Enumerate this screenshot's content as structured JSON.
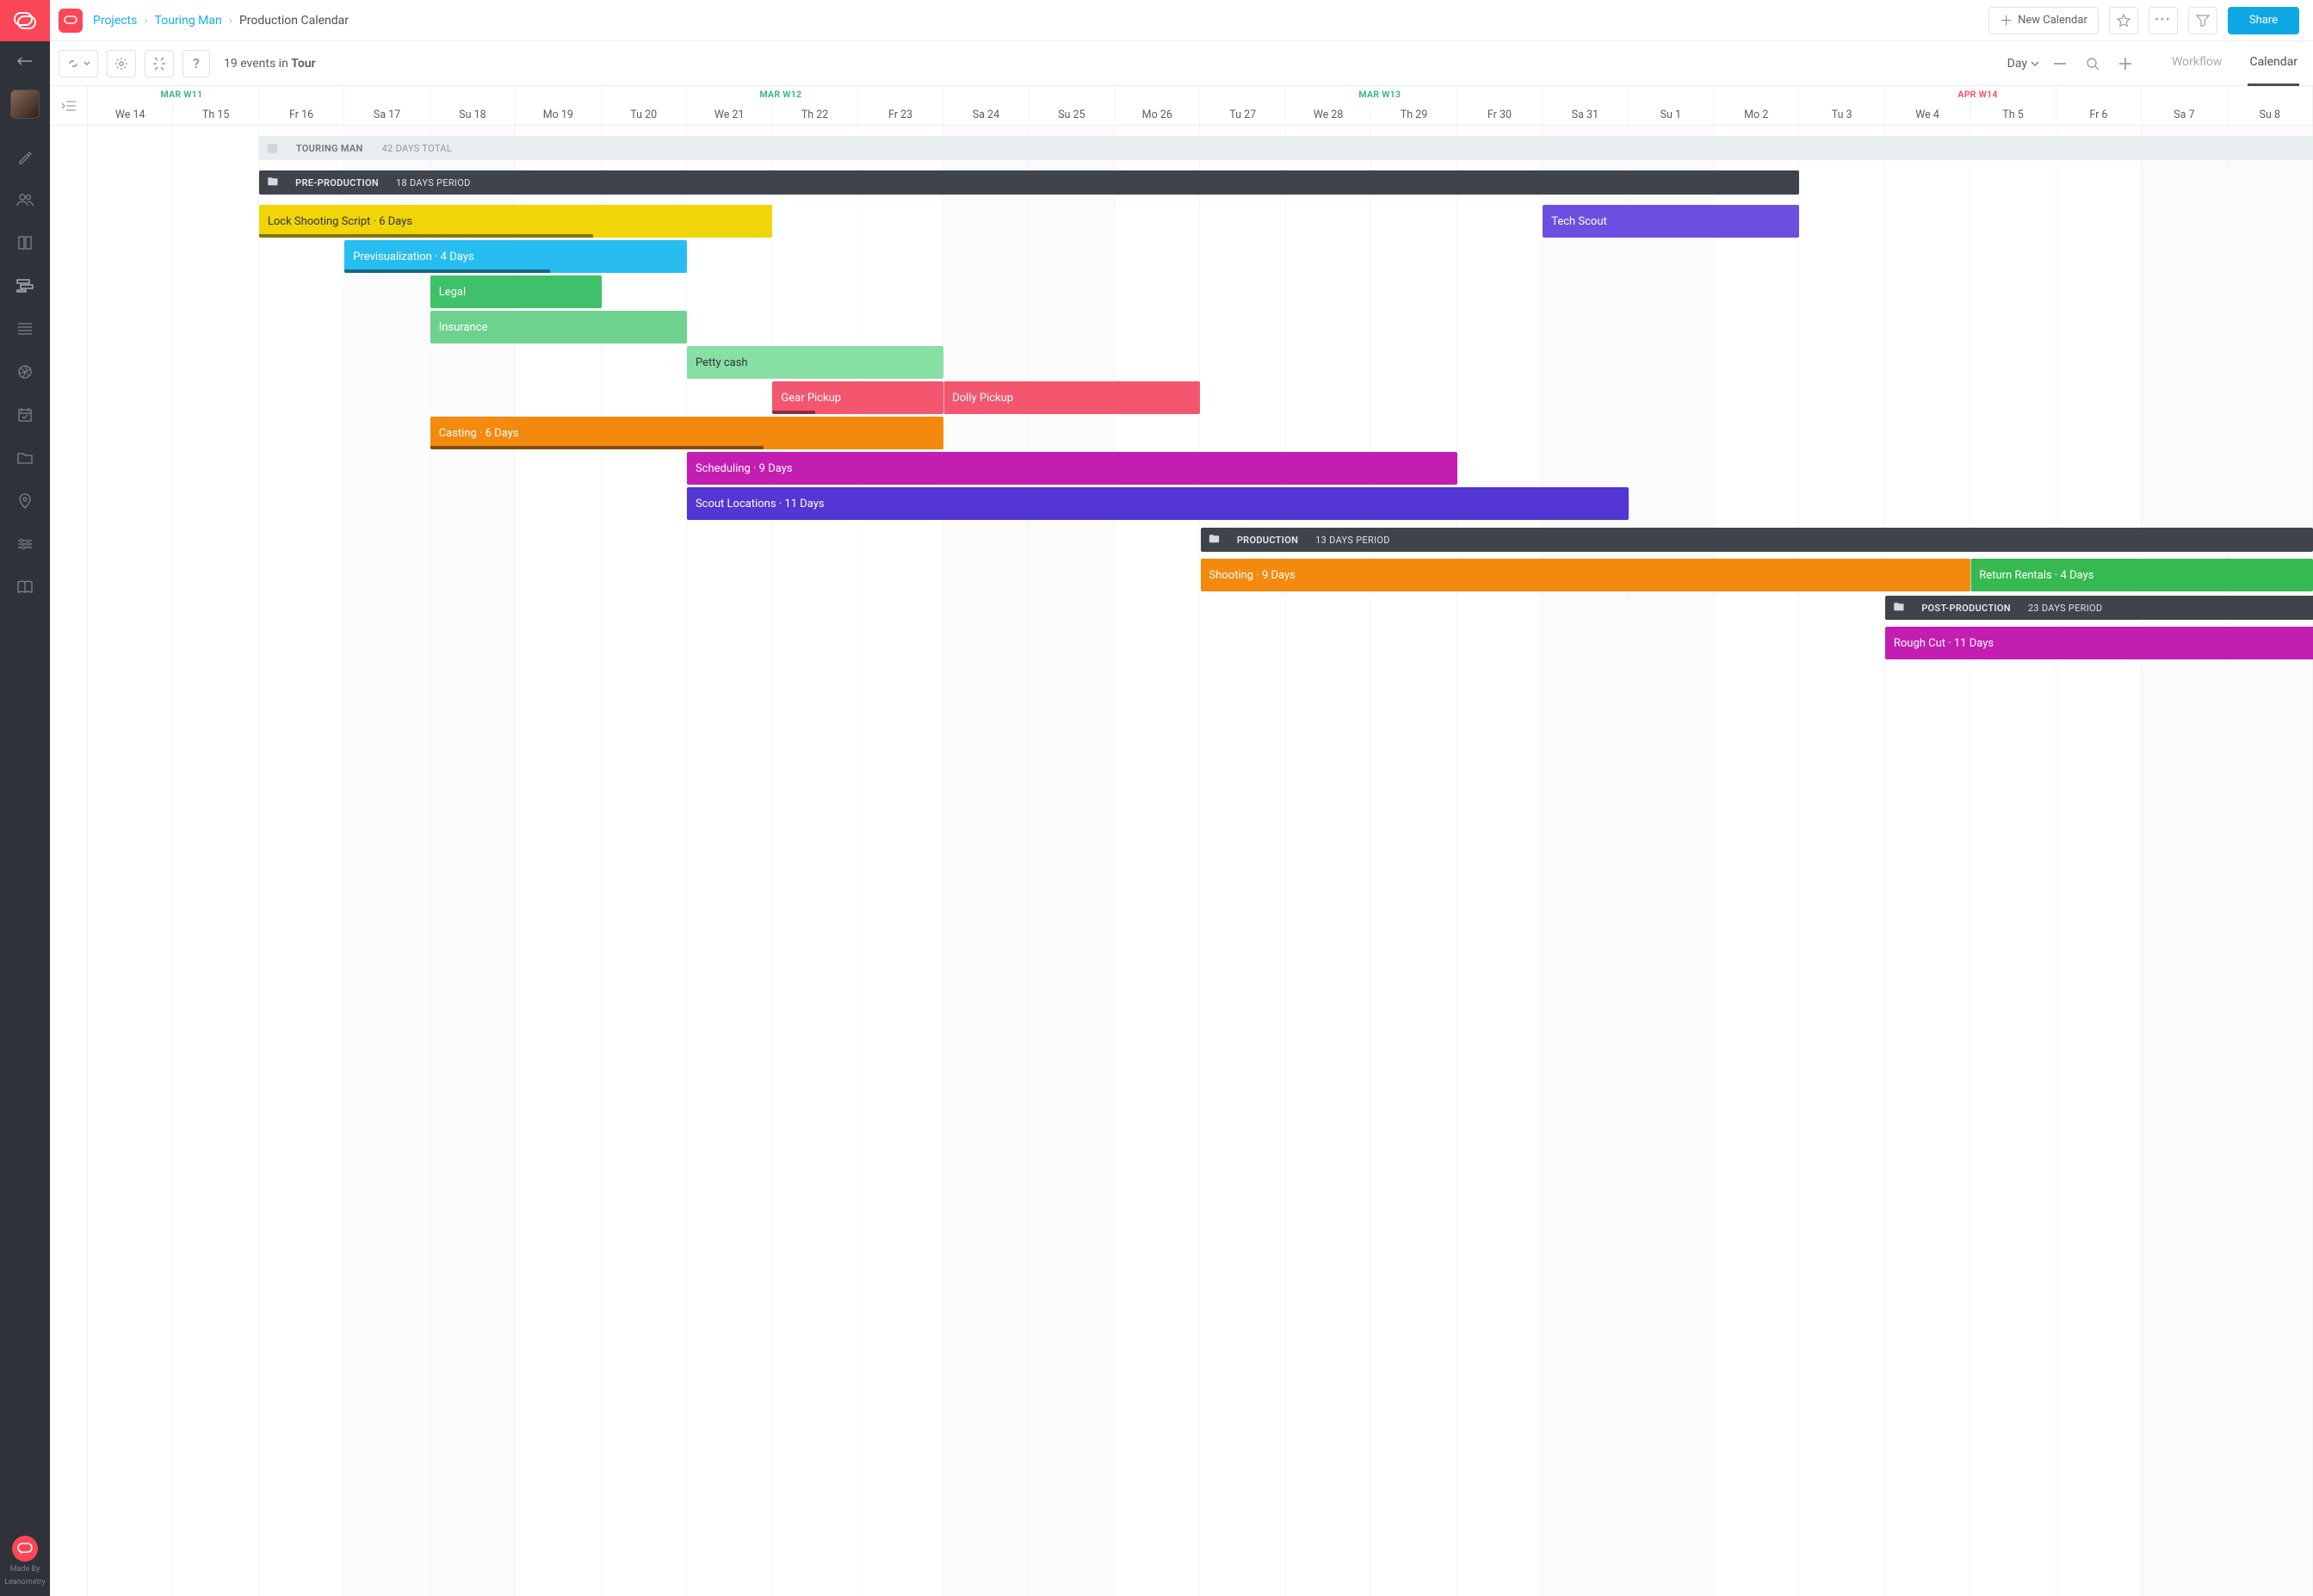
{
  "breadcrumb": {
    "projects": "Projects",
    "project": "Touring Man",
    "page": "Production Calendar"
  },
  "header": {
    "new_calendar": "New Calendar",
    "share": "Share"
  },
  "toolbar": {
    "status_count": "19 events in ",
    "status_bold": "Tour",
    "zoom_label": "Day",
    "tab_workflow": "Workflow",
    "tab_calendar": "Calendar"
  },
  "weeks": [
    {
      "label": "MAR  W11",
      "cls": "mar",
      "col": 1
    },
    {
      "label": "MAR  W12",
      "cls": "mar",
      "col": 8
    },
    {
      "label": "MAR  W13",
      "cls": "mar",
      "col": 15
    },
    {
      "label": "APR  W14",
      "cls": "apr",
      "col": 22
    }
  ],
  "days": [
    "We 14",
    "Th 15",
    "Fr 16",
    "Sa 17",
    "Su 18",
    "Mo 19",
    "Tu 20",
    "We 21",
    "Th 22",
    "Fr 23",
    "Sa 24",
    "Su 25",
    "Mo 26",
    "Tu 27",
    "We 28",
    "Th 29",
    "Fr 30",
    "Sa 31",
    "Su 1",
    "Mo 2",
    "Tu 3",
    "We 4",
    "Th 5",
    "Fr 6",
    "Sa 7",
    "Su 8"
  ],
  "weekend_cols": [
    3,
    4,
    10,
    11,
    17,
    18,
    24,
    25
  ],
  "rows": {
    "summary": {
      "label": "TOURING MAN",
      "sub": "42 DAYS TOTAL",
      "start": 2,
      "span": 25
    },
    "pre_phase": {
      "label": "PRE-PRODUCTION",
      "sub": "18 DAYS PERIOD",
      "start": 2,
      "span": 18
    },
    "prod_phase": {
      "label": "PRODUCTION",
      "sub": "13 DAYS PERIOD",
      "start": 13,
      "span": 13
    },
    "post_phase": {
      "label": "POST-PRODUCTION",
      "sub": "23 DAYS PERIOD",
      "start": 21,
      "span": 6
    }
  },
  "tasks": [
    {
      "id": "lock",
      "label": "Lock Shooting Script · 6 Days",
      "start": 2,
      "span": 6,
      "color": "#f1d506",
      "text": "light",
      "row": 0,
      "prog": 65
    },
    {
      "id": "tech",
      "label": "Tech Scout",
      "start": 17,
      "span": 3,
      "color": "#6b4fe0",
      "row": 0
    },
    {
      "id": "previz",
      "label": "Previsualization · 4 Days",
      "start": 3,
      "span": 4,
      "color": "#28bdf1",
      "row": 1,
      "prog": 60
    },
    {
      "id": "legal",
      "label": "Legal",
      "start": 4,
      "span": 2,
      "color": "#3fc06a",
      "row": 2
    },
    {
      "id": "ins",
      "label": "Insurance",
      "start": 4,
      "span": 3,
      "color": "#6dd28e",
      "row": 3
    },
    {
      "id": "petty",
      "label": "Petty cash",
      "start": 7,
      "span": 3,
      "color": "#88dfa4",
      "text": "light",
      "row": 4
    },
    {
      "id": "gear",
      "label": "Gear Pickup",
      "start": 8,
      "span": 2,
      "color": "#f5566f",
      "row": 5,
      "prog": 25
    },
    {
      "id": "dolly",
      "label": "Dolly Pickup",
      "start": 10,
      "span": 3,
      "color": "#f5566f",
      "row": 5,
      "sep": true
    },
    {
      "id": "cast",
      "label": "Casting · 6 Days",
      "start": 4,
      "span": 6,
      "color": "#f38a0e",
      "row": 6,
      "prog": 65
    },
    {
      "id": "sched",
      "label": "Scheduling · 9 Days",
      "start": 7,
      "span": 9,
      "color": "#c31db1",
      "row": 7
    },
    {
      "id": "scout",
      "label": "Scout Locations · 11 Days",
      "start": 7,
      "span": 11,
      "color": "#5336d3",
      "row": 8
    },
    {
      "id": "shoot",
      "label": "Shooting · 9 Days",
      "start": 13,
      "span": 9,
      "color": "#f38a0e",
      "row": 9
    },
    {
      "id": "return",
      "label": "Return Rentals · 4 Days",
      "start": 22,
      "span": 4,
      "color": "#36b951",
      "row": 9,
      "sep": true
    },
    {
      "id": "rough",
      "label": "Rough Cut · 11 Days",
      "start": 21,
      "span": 6,
      "color": "#c31db1",
      "row": 10
    }
  ],
  "footer": {
    "made_by": "Made By",
    "brand": "Leanometry"
  }
}
